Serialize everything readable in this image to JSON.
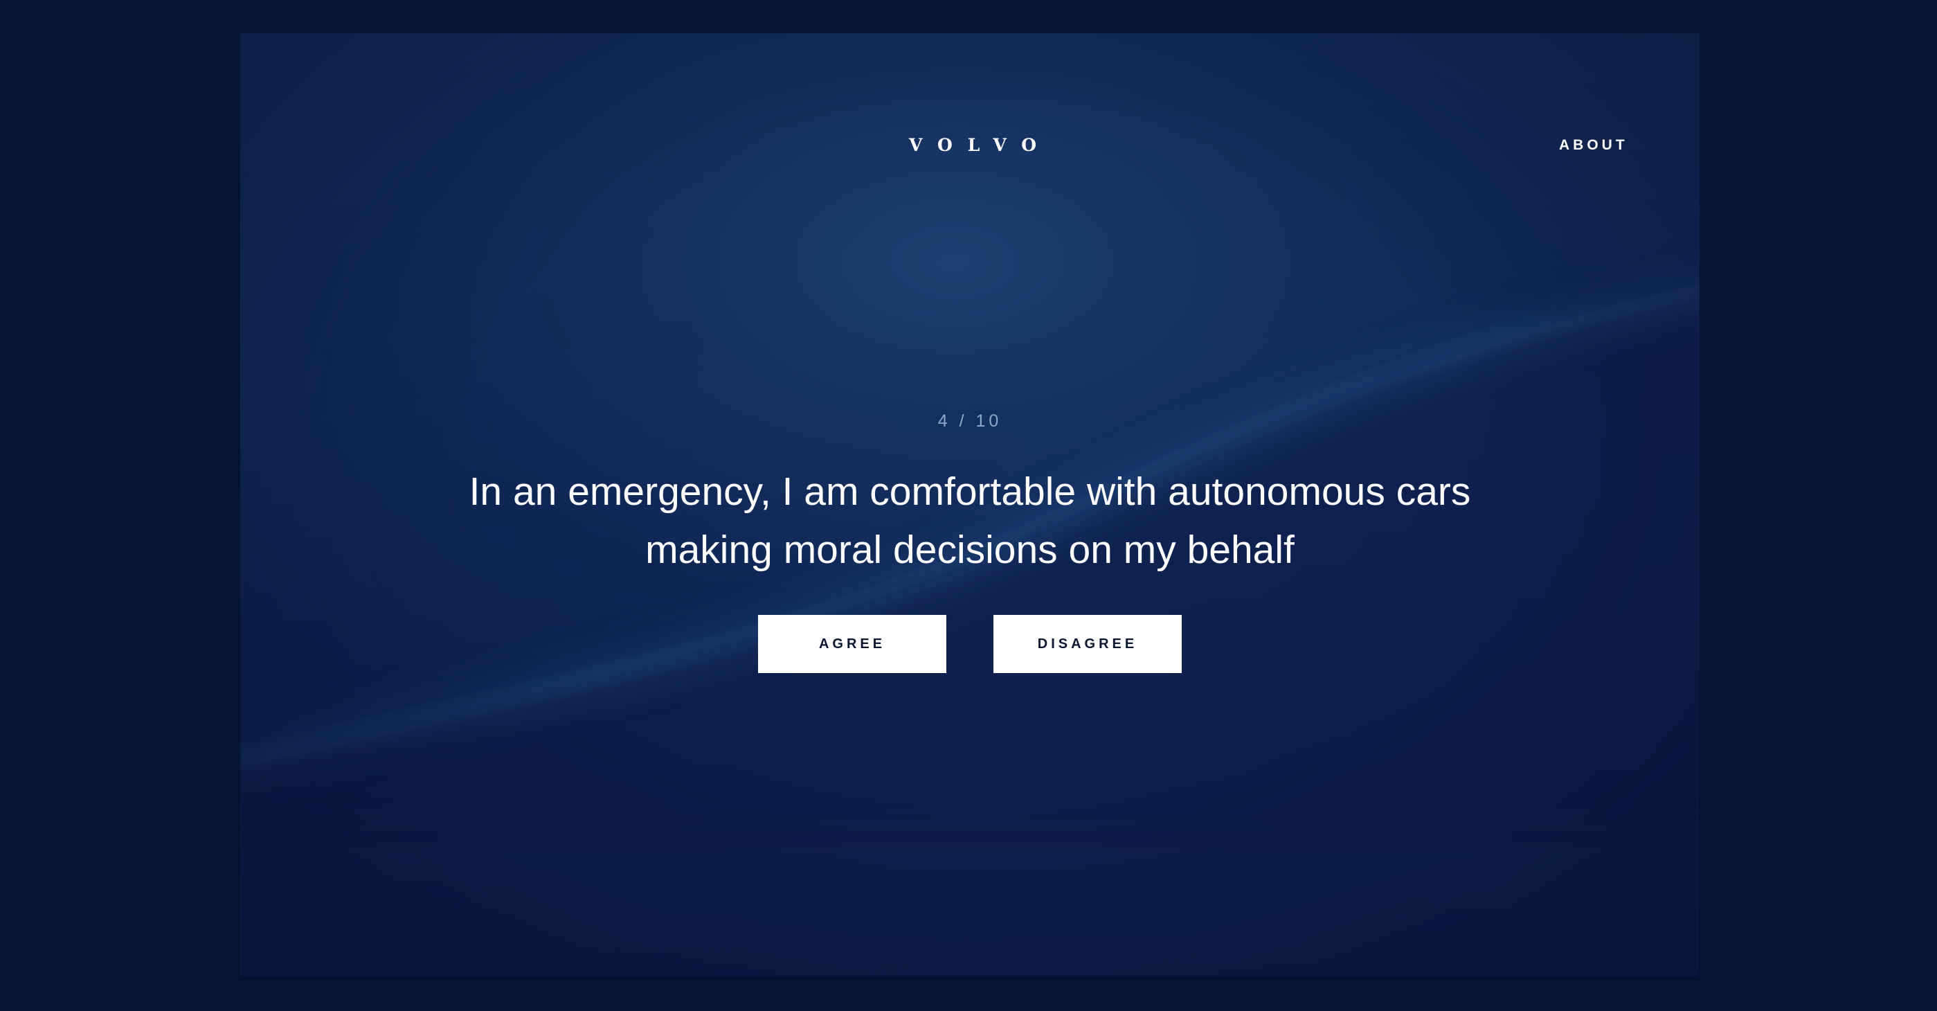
{
  "brand": {
    "logo_text": "VOLVO"
  },
  "nav": {
    "about_label": "ABOUT"
  },
  "survey": {
    "progress": "4 / 10",
    "current": 4,
    "total": 10,
    "question": "In an emergency, I am comfortable with autonomous cars making moral decisions on my behalf",
    "agree_label": "AGREE",
    "disagree_label": "DISAGREE"
  },
  "colors": {
    "backdrop": "#04142e",
    "screen_bg": "#112a5a",
    "text": "#ffffff",
    "muted_text": "#8fa7c9",
    "button_bg": "#ffffff",
    "button_text": "#0b1630"
  }
}
